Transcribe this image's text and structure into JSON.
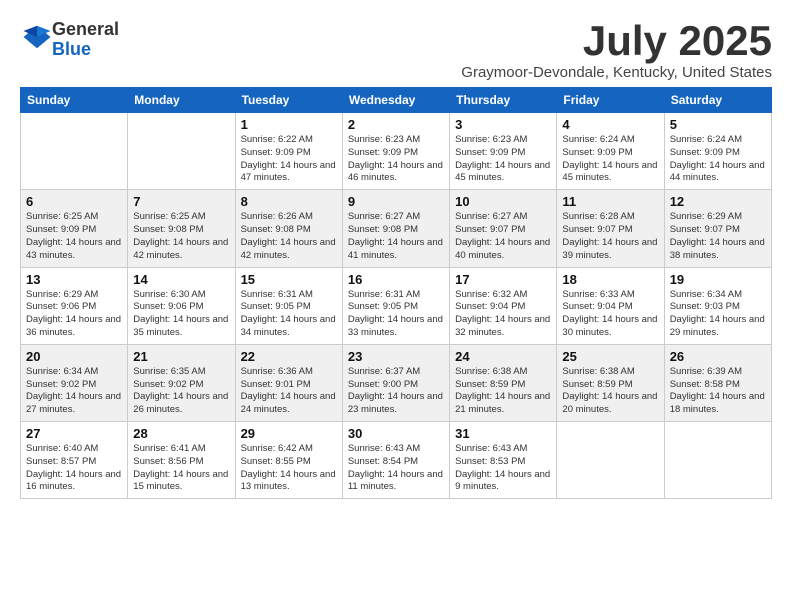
{
  "header": {
    "logo_line1": "General",
    "logo_line2": "Blue",
    "month": "July 2025",
    "location": "Graymoor-Devondale, Kentucky, United States"
  },
  "weekdays": [
    "Sunday",
    "Monday",
    "Tuesday",
    "Wednesday",
    "Thursday",
    "Friday",
    "Saturday"
  ],
  "weeks": [
    [
      {
        "day": "",
        "info": ""
      },
      {
        "day": "",
        "info": ""
      },
      {
        "day": "1",
        "info": "Sunrise: 6:22 AM\nSunset: 9:09 PM\nDaylight: 14 hours and 47 minutes."
      },
      {
        "day": "2",
        "info": "Sunrise: 6:23 AM\nSunset: 9:09 PM\nDaylight: 14 hours and 46 minutes."
      },
      {
        "day": "3",
        "info": "Sunrise: 6:23 AM\nSunset: 9:09 PM\nDaylight: 14 hours and 45 minutes."
      },
      {
        "day": "4",
        "info": "Sunrise: 6:24 AM\nSunset: 9:09 PM\nDaylight: 14 hours and 45 minutes."
      },
      {
        "day": "5",
        "info": "Sunrise: 6:24 AM\nSunset: 9:09 PM\nDaylight: 14 hours and 44 minutes."
      }
    ],
    [
      {
        "day": "6",
        "info": "Sunrise: 6:25 AM\nSunset: 9:09 PM\nDaylight: 14 hours and 43 minutes."
      },
      {
        "day": "7",
        "info": "Sunrise: 6:25 AM\nSunset: 9:08 PM\nDaylight: 14 hours and 42 minutes."
      },
      {
        "day": "8",
        "info": "Sunrise: 6:26 AM\nSunset: 9:08 PM\nDaylight: 14 hours and 42 minutes."
      },
      {
        "day": "9",
        "info": "Sunrise: 6:27 AM\nSunset: 9:08 PM\nDaylight: 14 hours and 41 minutes."
      },
      {
        "day": "10",
        "info": "Sunrise: 6:27 AM\nSunset: 9:07 PM\nDaylight: 14 hours and 40 minutes."
      },
      {
        "day": "11",
        "info": "Sunrise: 6:28 AM\nSunset: 9:07 PM\nDaylight: 14 hours and 39 minutes."
      },
      {
        "day": "12",
        "info": "Sunrise: 6:29 AM\nSunset: 9:07 PM\nDaylight: 14 hours and 38 minutes."
      }
    ],
    [
      {
        "day": "13",
        "info": "Sunrise: 6:29 AM\nSunset: 9:06 PM\nDaylight: 14 hours and 36 minutes."
      },
      {
        "day": "14",
        "info": "Sunrise: 6:30 AM\nSunset: 9:06 PM\nDaylight: 14 hours and 35 minutes."
      },
      {
        "day": "15",
        "info": "Sunrise: 6:31 AM\nSunset: 9:05 PM\nDaylight: 14 hours and 34 minutes."
      },
      {
        "day": "16",
        "info": "Sunrise: 6:31 AM\nSunset: 9:05 PM\nDaylight: 14 hours and 33 minutes."
      },
      {
        "day": "17",
        "info": "Sunrise: 6:32 AM\nSunset: 9:04 PM\nDaylight: 14 hours and 32 minutes."
      },
      {
        "day": "18",
        "info": "Sunrise: 6:33 AM\nSunset: 9:04 PM\nDaylight: 14 hours and 30 minutes."
      },
      {
        "day": "19",
        "info": "Sunrise: 6:34 AM\nSunset: 9:03 PM\nDaylight: 14 hours and 29 minutes."
      }
    ],
    [
      {
        "day": "20",
        "info": "Sunrise: 6:34 AM\nSunset: 9:02 PM\nDaylight: 14 hours and 27 minutes."
      },
      {
        "day": "21",
        "info": "Sunrise: 6:35 AM\nSunset: 9:02 PM\nDaylight: 14 hours and 26 minutes."
      },
      {
        "day": "22",
        "info": "Sunrise: 6:36 AM\nSunset: 9:01 PM\nDaylight: 14 hours and 24 minutes."
      },
      {
        "day": "23",
        "info": "Sunrise: 6:37 AM\nSunset: 9:00 PM\nDaylight: 14 hours and 23 minutes."
      },
      {
        "day": "24",
        "info": "Sunrise: 6:38 AM\nSunset: 8:59 PM\nDaylight: 14 hours and 21 minutes."
      },
      {
        "day": "25",
        "info": "Sunrise: 6:38 AM\nSunset: 8:59 PM\nDaylight: 14 hours and 20 minutes."
      },
      {
        "day": "26",
        "info": "Sunrise: 6:39 AM\nSunset: 8:58 PM\nDaylight: 14 hours and 18 minutes."
      }
    ],
    [
      {
        "day": "27",
        "info": "Sunrise: 6:40 AM\nSunset: 8:57 PM\nDaylight: 14 hours and 16 minutes."
      },
      {
        "day": "28",
        "info": "Sunrise: 6:41 AM\nSunset: 8:56 PM\nDaylight: 14 hours and 15 minutes."
      },
      {
        "day": "29",
        "info": "Sunrise: 6:42 AM\nSunset: 8:55 PM\nDaylight: 14 hours and 13 minutes."
      },
      {
        "day": "30",
        "info": "Sunrise: 6:43 AM\nSunset: 8:54 PM\nDaylight: 14 hours and 11 minutes."
      },
      {
        "day": "31",
        "info": "Sunrise: 6:43 AM\nSunset: 8:53 PM\nDaylight: 14 hours and 9 minutes."
      },
      {
        "day": "",
        "info": ""
      },
      {
        "day": "",
        "info": ""
      }
    ]
  ]
}
